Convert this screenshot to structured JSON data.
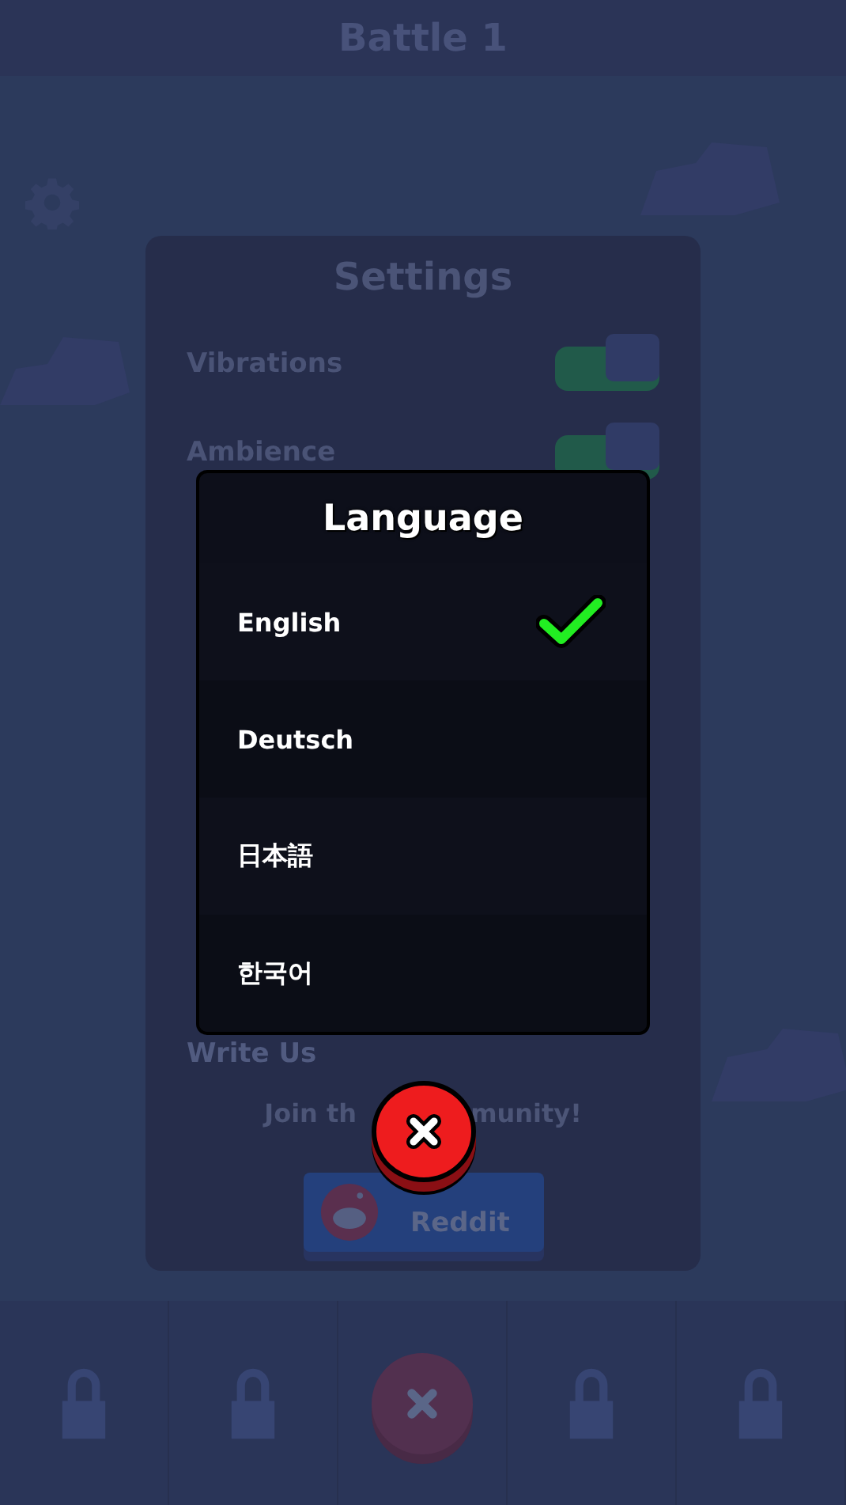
{
  "header": {
    "title": "Battle 1"
  },
  "settings": {
    "title": "Settings",
    "toggles": [
      {
        "label": "Vibrations",
        "on": true
      },
      {
        "label": "Ambience",
        "on": true
      }
    ],
    "write_us": "Write Us",
    "community": [
      "Join th",
      "munity!"
    ],
    "reddit_button": "Reddit"
  },
  "language_dialog": {
    "title": "Language",
    "options": [
      {
        "label": "English",
        "selected": true
      },
      {
        "label": "Deutsch",
        "selected": false
      },
      {
        "label": "日本語",
        "selected": false
      },
      {
        "label": "한국어",
        "selected": false
      }
    ]
  },
  "bottom_nav": {
    "tabs": [
      {
        "kind": "locked"
      },
      {
        "kind": "locked"
      },
      {
        "kind": "close"
      },
      {
        "kind": "locked"
      },
      {
        "kind": "locked"
      }
    ]
  }
}
